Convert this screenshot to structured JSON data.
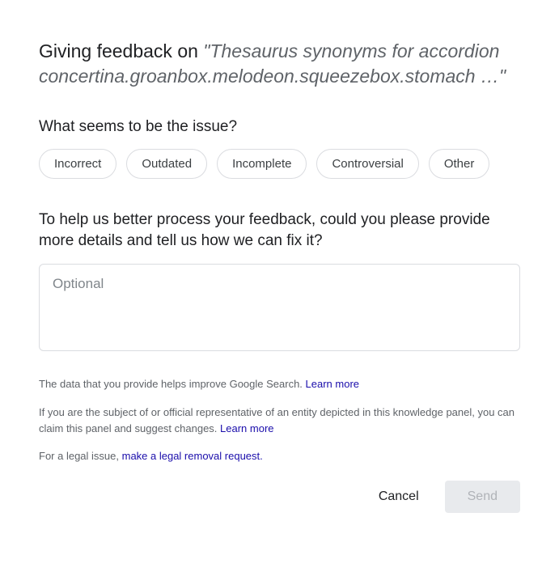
{
  "header": {
    "prefix": "Giving feedback on ",
    "quoted": "\"Thesaurus synonyms for accordion concertina.groanbox.melodeon.squeezebox.stomach …\""
  },
  "issue": {
    "label": "What seems to be the issue?",
    "options": [
      "Incorrect",
      "Outdated",
      "Incomplete",
      "Controversial",
      "Other"
    ]
  },
  "details": {
    "label": "To help us better process your feedback, could you please provide more details and tell us how we can fix it?",
    "placeholder": "Optional",
    "value": ""
  },
  "disclaimers": {
    "line1_text": "The data that you provide helps improve Google Search.  ",
    "line1_link": "Learn more",
    "line2_text": "If you are the subject of or official representative of an entity depicted in this knowledge panel, you can claim this panel and suggest changes.  ",
    "line2_link": "Learn more",
    "line3_text": "For a legal issue,  ",
    "line3_link": "make a legal removal request."
  },
  "actions": {
    "cancel": "Cancel",
    "send": "Send"
  }
}
